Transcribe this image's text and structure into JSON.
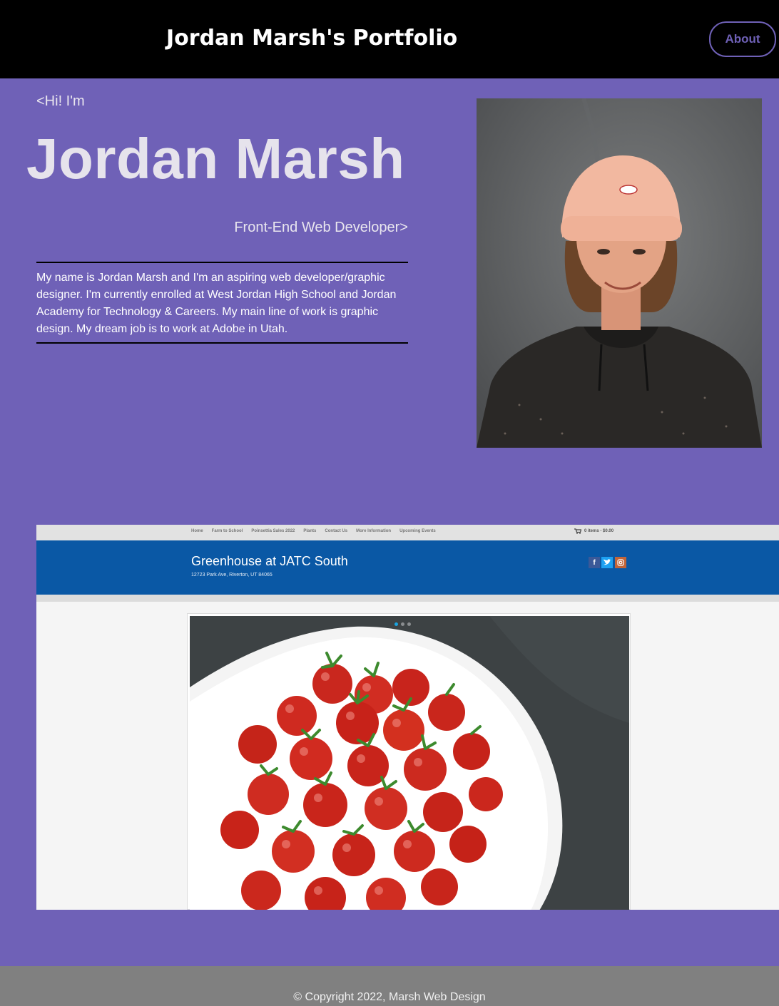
{
  "header": {
    "title": "Jordan Marsh's Portfolio",
    "about_label": "About"
  },
  "hero": {
    "greeting": "<Hi! I'm",
    "name": "Jordan Marsh",
    "role": "Front-End Web Developer>",
    "bio": "My name is Jordan Marsh and I'm an aspiring web developer/graphic designer. I'm currently enrolled at West Jordan High School and Jordan Academy for Technology & Careers. My main line of work is graphic design. My dream job is to work at Adobe in Utah."
  },
  "project_screenshot": {
    "nav_items": [
      "Home",
      "Farm to School",
      "Poinsettia Sales 2022",
      "Plants",
      "Contact Us",
      "More Information",
      "Upcoming Events"
    ],
    "cart_text": "0 items - $0.00",
    "site_title": "Greenhouse at JATC South",
    "address": "12723 Park Ave, Riverton, UT 84065",
    "social_icons": [
      "facebook-icon",
      "twitter-icon",
      "instagram-icon"
    ],
    "slider_dots": 3,
    "active_dot": 0
  },
  "footer": {
    "copyright": "© Copyright 2022, Marsh Web Design"
  },
  "colors": {
    "page_background": "#6f61b7",
    "header_background": "#000000",
    "footer_background": "#808080",
    "accent": "#6f61b7",
    "project_header_blue": "#0a58a5"
  }
}
